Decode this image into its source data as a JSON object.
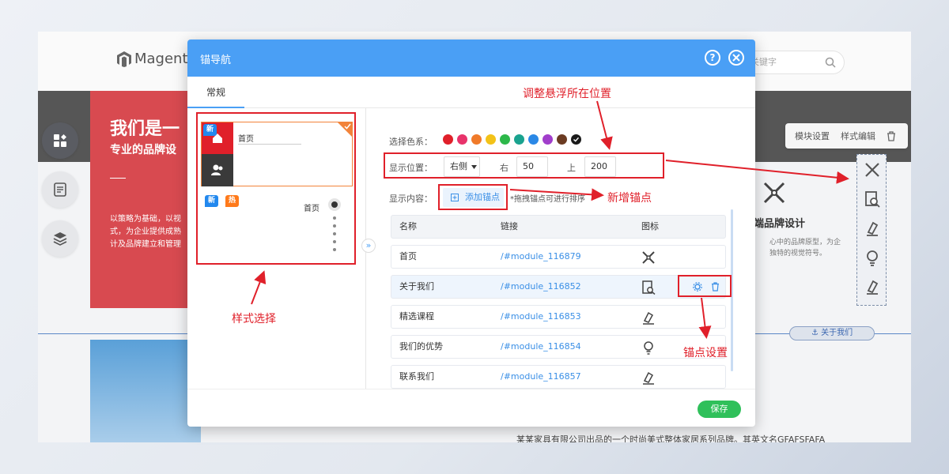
{
  "background": {
    "logo_text": "Magento",
    "search_placeholder": "关键字",
    "hero_title": "我们是一",
    "hero_subtitle": "专业的品牌设",
    "hero_desc_lines": [
      "以策略为基础，以视",
      "式，为企业提供成熟",
      "计及品牌建立和管理"
    ],
    "toolbar_items": [
      "模块设置",
      "样式编辑"
    ],
    "brand_title": "端品牌设计",
    "brand_desc_lines": [
      "心中的品牌原型，为企",
      "独特的视觉符号。"
    ],
    "anchor_tag": "关于我们",
    "footer_text": "某某家具有限公司出品的一个时尚美式整体家居系列品牌。其英文名GFAFSFAFA"
  },
  "dialog": {
    "title": "锚导航",
    "tab": "常规",
    "save_label": "保存",
    "style_cards": {
      "card1_badge": "新",
      "card1_label": "首页",
      "card2_badge_new": "新",
      "card2_badge_hot": "热",
      "card2_label": "首页"
    },
    "color_label": "选择色系：",
    "colors": [
      "#e0202a",
      "#e8336b",
      "#f07a2a",
      "#f3c218",
      "#2db84a",
      "#1aa38f",
      "#2a88e6",
      "#a13ecb",
      "#6b3b22",
      "#1a1a1a"
    ],
    "position_label": "显示位置：",
    "position_value": "右侧",
    "right_label": "右",
    "right_value": "50",
    "top_label": "上",
    "top_value": "200",
    "content_label": "显示内容：",
    "add_anchor_label": "添加锚点",
    "drag_hint": "*拖拽锚点可进行排序",
    "table": {
      "headers": [
        "名称",
        "链接",
        "图标"
      ],
      "rows": [
        {
          "name": "首页",
          "link": "/#module_116879",
          "icon": "pencil-ruler-icon"
        },
        {
          "name": "关于我们",
          "link": "/#module_116852",
          "icon": "search-doc-icon"
        },
        {
          "name": "精选课程",
          "link": "/#module_116853",
          "icon": "hammer-icon"
        },
        {
          "name": "我们的优势",
          "link": "/#module_116854",
          "icon": "lightbulb-icon"
        },
        {
          "name": "联系我们",
          "link": "/#module_116857",
          "icon": "hammer-icon"
        }
      ]
    }
  },
  "annotations": {
    "position_note": "调整悬浮所在位置",
    "add_note": "新增锚点",
    "style_note": "样式选择",
    "anchor_setting_note": "锚点设置"
  },
  "accent_color": "#4a9ff5",
  "annotation_color": "#e0202a",
  "save_color": "#2fc05a"
}
